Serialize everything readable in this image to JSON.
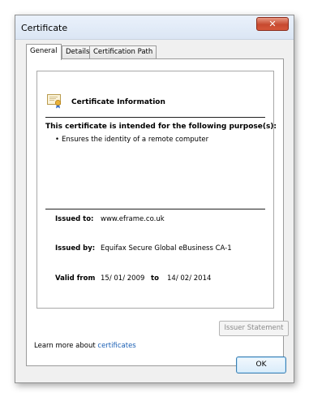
{
  "window": {
    "title": "Certificate",
    "close_glyph": "✕"
  },
  "tabs": [
    {
      "label": "General",
      "active": true
    },
    {
      "label": "Details",
      "active": false
    },
    {
      "label": "Certification Path",
      "active": false
    }
  ],
  "info": {
    "icon": "certificate-icon",
    "title": "Certificate Information",
    "purpose_heading": "This certificate is intended for the following purpose(s):",
    "purposes": [
      "Ensures the identity of a remote computer"
    ]
  },
  "fields": {
    "issued_to_label": "Issued to:",
    "issued_to": "www.eframe.co.uk",
    "issued_by_label": "Issued by:",
    "issued_by": "Equifax Secure Global eBusiness CA-1",
    "valid_from_label": "Valid from",
    "valid_from": "15/ 01/ 2009",
    "valid_to_label": "to",
    "valid_to": "14/ 02/ 2014"
  },
  "buttons": {
    "issuer_statement": "Issuer Statement",
    "ok": "OK"
  },
  "learn_more": {
    "prefix": "Learn more about ",
    "link": "certificates"
  },
  "colors": {
    "link": "#1a5fb4",
    "close_button": "#c74a2f",
    "ok_border": "#3c7fb1"
  }
}
